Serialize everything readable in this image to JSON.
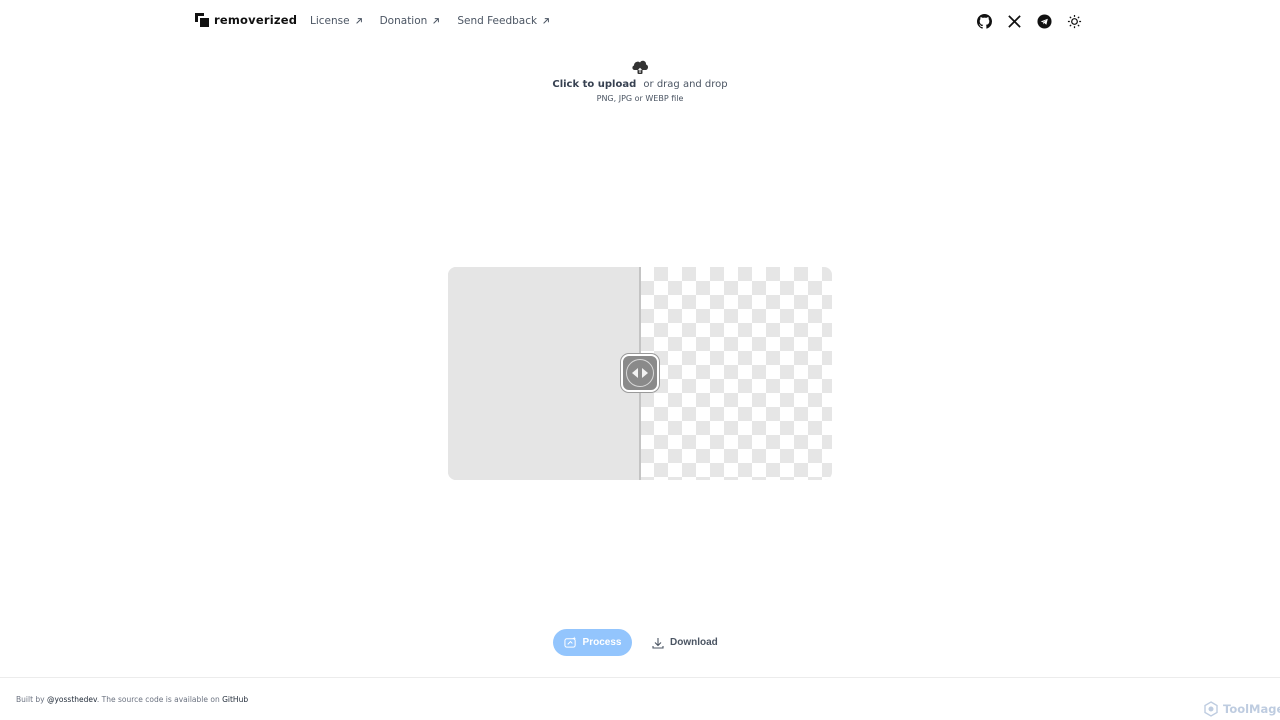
{
  "header": {
    "logo_text": "removerized",
    "nav": [
      {
        "label": "License"
      },
      {
        "label": "Donation"
      },
      {
        "label": "Send Feedback"
      }
    ]
  },
  "upload": {
    "action_label": "Click to upload",
    "drag_label": "or drag and drop",
    "hint": "PNG, JPG or WEBP file"
  },
  "viewer": {
    "slider_position": 0.5
  },
  "actions": {
    "process_label": "Process",
    "download_label": "Download"
  },
  "footer": {
    "built_by": "Built by",
    "author": "@yossthedev",
    "middle": ". The source code is available on",
    "github": "GitHub"
  },
  "watermark": {
    "text": "ToolMage"
  },
  "colors": {
    "primary": "#93c5fd",
    "text": "#1f2937",
    "muted": "#4b5563"
  }
}
